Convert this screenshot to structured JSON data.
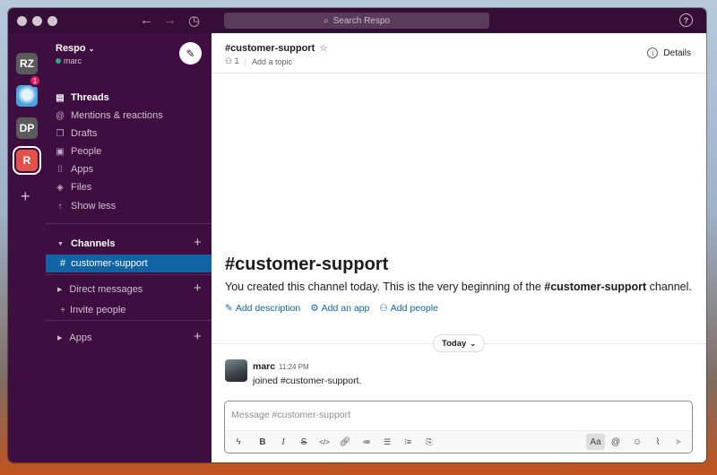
{
  "titlebar": {
    "search_placeholder": "Search Respo",
    "icons": [
      "back-arrow-icon",
      "forward-arrow-icon",
      "history-icon",
      "help-icon"
    ]
  },
  "rail": {
    "workspaces": [
      {
        "label": "RZ",
        "color": "#5b5b5b"
      },
      {
        "label": "",
        "color": "#4aa3df",
        "badge": "1"
      },
      {
        "label": "DP",
        "color": "#5b5b5b"
      },
      {
        "label": "R",
        "color": "#e0524a"
      }
    ]
  },
  "sidebar": {
    "workspace_name": "Respo",
    "user": "marc",
    "nav": [
      {
        "label": "Threads",
        "icon": "threads-icon"
      },
      {
        "label": "Mentions & reactions",
        "icon": "at-icon"
      },
      {
        "label": "Drafts",
        "icon": "drafts-icon"
      },
      {
        "label": "People",
        "icon": "people-icon"
      },
      {
        "label": "Apps",
        "icon": "apps-grid-icon"
      },
      {
        "label": "Files",
        "icon": "files-icon"
      },
      {
        "label": "Show less",
        "icon": "arrow-up-icon"
      }
    ],
    "channels_label": "Channels",
    "active_channel": "customer-support",
    "dm_label": "Direct messages",
    "invite_label": "Invite people",
    "apps_label": "Apps"
  },
  "channel": {
    "name": "#customer-support",
    "member_count": "1",
    "add_topic": "Add a topic",
    "details_label": "Details"
  },
  "intro": {
    "heading": "#customer-support",
    "text_before": "You created this channel today. This is the very beginning of the ",
    "channel_bold": "#customer-support",
    "text_after": " channel.",
    "links": [
      "Add description",
      "Add an app",
      "Add people"
    ]
  },
  "divider": {
    "label": "Today"
  },
  "message": {
    "author": "marc",
    "time": "11:24 PM",
    "body": "joined #customer-support."
  },
  "composer": {
    "placeholder": "Message #customer-support",
    "format_label": "Aa"
  }
}
